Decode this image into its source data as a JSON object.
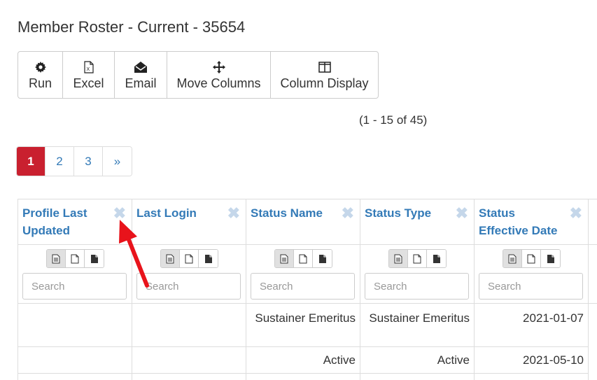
{
  "page": {
    "title": "Member Roster - Current - 35654"
  },
  "toolbar": {
    "buttons": [
      {
        "label": "Run",
        "icon": "gear-icon"
      },
      {
        "label": "Excel",
        "icon": "excel-file-icon"
      },
      {
        "label": "Email",
        "icon": "envelope-open-icon"
      },
      {
        "label": "Move Columns",
        "icon": "move-arrows-icon"
      },
      {
        "label": "Column Display",
        "icon": "columns-icon"
      }
    ]
  },
  "results": {
    "count_text": "(1 - 15 of 45)"
  },
  "pagination": {
    "pages": [
      "1",
      "2",
      "3"
    ],
    "next": "»",
    "active": "1",
    "active_color": "#c9202f"
  },
  "grid": {
    "remove_glyph": "✖",
    "search_placeholder": "Search",
    "columns": [
      {
        "header": "Profile Last Updated"
      },
      {
        "header": "Last Login"
      },
      {
        "header": "Status Name"
      },
      {
        "header": "Status Type"
      },
      {
        "header": "Status Effective Date"
      }
    ],
    "rows": [
      [
        "",
        "",
        "Sustainer Emeritus",
        "Sustainer Emeritus",
        "2021-01-07"
      ],
      [
        "",
        "",
        "Active",
        "Active",
        "2021-05-10"
      ]
    ]
  },
  "colors": {
    "link": "#337ab7",
    "annotation_arrow": "#e8131b"
  }
}
